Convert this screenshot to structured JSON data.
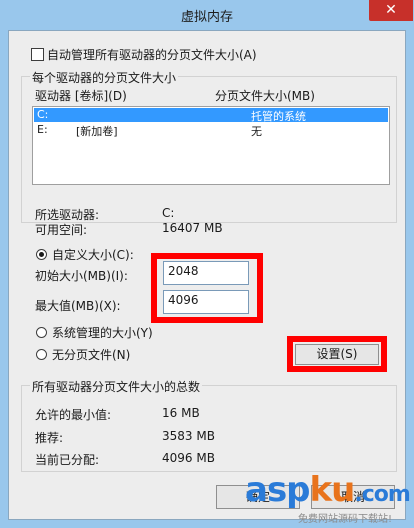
{
  "window": {
    "title": "虚拟内存",
    "close_glyph": "✕"
  },
  "auto_manage": {
    "label": "自动管理所有驱动器的分页文件大小(A)",
    "checked": false
  },
  "per_drive_group": {
    "legend": "每个驱动器的分页文件大小"
  },
  "drive_list": {
    "col_drive": "驱动器 [卷标](D)",
    "col_size": "分页文件大小(MB)",
    "rows": [
      {
        "drive": "C:",
        "label": "",
        "size": "托管的系统",
        "selected": true
      },
      {
        "drive": "E:",
        "label": "[新加卷]",
        "size": "无",
        "selected": false
      }
    ]
  },
  "selected_drive": {
    "label": "所选驱动器:",
    "value": "C:",
    "free_label": "可用空间:",
    "free_value": "16407 MB"
  },
  "custom_size": {
    "label": "自定义大小(C):",
    "selected": true,
    "initial_label": "初始大小(MB)(I):",
    "initial_value": "2048",
    "max_label": "最大值(MB)(X):",
    "max_value": "4096"
  },
  "system_managed": {
    "label": "系统管理的大小(Y)",
    "selected": false
  },
  "no_paging": {
    "label": "无分页文件(N)",
    "selected": false
  },
  "set_button": {
    "label": "设置(S)"
  },
  "totals_group": {
    "legend": "所有驱动器分页文件大小的总数",
    "min_label": "允许的最小值:",
    "min_value": "16 MB",
    "recommended_label": "推荐:",
    "recommended_value": "3583 MB",
    "current_label": "当前已分配:",
    "current_value": "4096 MB"
  },
  "footer_buttons": {
    "ok_label": "确定",
    "cancel_label": "取消"
  },
  "watermark": {
    "brand": "aspku",
    "suffix": ".com",
    "tagline": "免费网站源码下载站!"
  },
  "colors": {
    "highlight": "#ff0000",
    "selection": "#3399ff",
    "title_bar": "#99c7ec",
    "close": "#c7302a"
  }
}
